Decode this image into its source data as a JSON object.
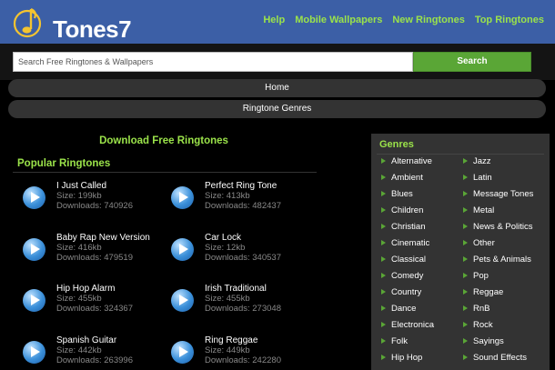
{
  "brand": {
    "name": "Tones7"
  },
  "topnav": [
    "Help",
    "Mobile Wallpapers",
    "New Ringtones",
    "Top Ringtones"
  ],
  "search": {
    "placeholder": "Search Free Ringtones & Wallpapers",
    "button": "Search"
  },
  "nav": {
    "home": "Home",
    "genres": "Ringtone Genres"
  },
  "main": {
    "download_title": "Download Free Ringtones",
    "popular_title": "Popular Ringtones",
    "ringtones": [
      {
        "name": "I Just Called",
        "size": "Size: 199kb",
        "downloads": "Downloads: 740926"
      },
      {
        "name": "Perfect Ring Tone",
        "size": "Size: 413kb",
        "downloads": "Downloads: 482437"
      },
      {
        "name": "Baby Rap New Version",
        "size": "Size: 416kb",
        "downloads": "Downloads: 479519"
      },
      {
        "name": "Car Lock",
        "size": "Size: 12kb",
        "downloads": "Downloads: 340537"
      },
      {
        "name": "Hip Hop Alarm",
        "size": "Size: 455kb",
        "downloads": "Downloads: 324367"
      },
      {
        "name": "Irish Traditional",
        "size": "Size: 455kb",
        "downloads": "Downloads: 273048"
      },
      {
        "name": "Spanish Guitar",
        "size": "Size: 442kb",
        "downloads": "Downloads: 263996"
      },
      {
        "name": "Ring Reggae",
        "size": "Size: 449kb",
        "downloads": "Downloads: 242280"
      }
    ]
  },
  "genres": {
    "title": "Genres",
    "left": [
      "Alternative",
      "Ambient",
      "Blues",
      "Children",
      "Christian",
      "Cinematic",
      "Classical",
      "Comedy",
      "Country",
      "Dance",
      "Electronica",
      "Folk",
      "Hip Hop"
    ],
    "right": [
      "Jazz",
      "Latin",
      "Message Tones",
      "Metal",
      "News & Politics",
      "Other",
      "Pets & Animals",
      "Pop",
      "Reggae",
      "RnB",
      "Rock",
      "Sayings",
      "Sound Effects"
    ]
  },
  "colors": {
    "header": "#3c5fa6",
    "accent": "#9be34a",
    "button": "#5aa636",
    "panel": "#333333"
  }
}
